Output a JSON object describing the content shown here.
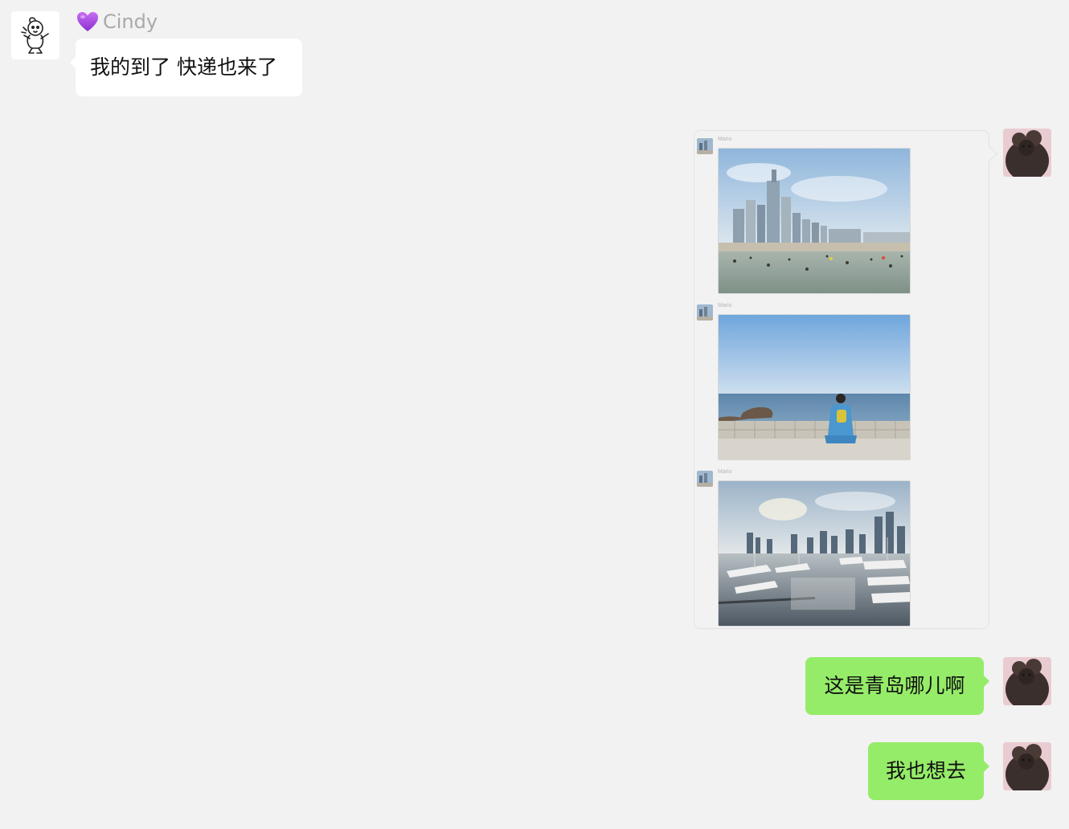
{
  "incoming": {
    "sender_emoji": "💜",
    "sender_name": "Cindy",
    "message": "我的到了 快递也来了"
  },
  "forwarded_chat": {
    "items": [
      {
        "sender_name": "Mario",
        "image": "beach-city-skyline-photo"
      },
      {
        "sender_name": "Mario",
        "image": "person-sitting-by-sea-photo"
      },
      {
        "sender_name": "Mario",
        "image": "marina-yachts-skyline-photo"
      }
    ]
  },
  "outgoing": [
    {
      "message": "这是青岛哪儿啊"
    },
    {
      "message": "我也想去"
    }
  ],
  "colors": {
    "background": "#f2f2f2",
    "incoming_bubble": "#ffffff",
    "outgoing_bubble": "#95ec69",
    "sender_name": "#a9a9a9"
  }
}
